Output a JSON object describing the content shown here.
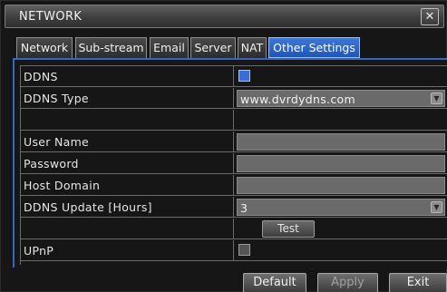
{
  "window": {
    "title": "NETWORK",
    "close_glyph": "✕"
  },
  "tabs": [
    {
      "label": "Network",
      "active": false
    },
    {
      "label": "Sub-stream",
      "active": false
    },
    {
      "label": "Email",
      "active": false
    },
    {
      "label": "Server",
      "active": false
    },
    {
      "label": "NAT",
      "active": false
    },
    {
      "label": "Other Settings",
      "active": true
    }
  ],
  "form": {
    "ddns": {
      "label": "DDNS",
      "checked": true
    },
    "ddns_type": {
      "label": "DDNS Type",
      "value": "www.dvrdydns.com"
    },
    "blank": {
      "label": ""
    },
    "user_name": {
      "label": "User Name",
      "value": ""
    },
    "password": {
      "label": "Password",
      "value": ""
    },
    "host_domain": {
      "label": "Host Domain",
      "value": ""
    },
    "ddns_update": {
      "label": "DDNS Update [Hours]",
      "value": "3"
    },
    "test": {
      "label": "Test"
    },
    "upnp": {
      "label": "UPnP",
      "checked": false
    }
  },
  "footer": {
    "default_label": "Default",
    "apply_label": "Apply",
    "exit_label": "Exit"
  },
  "colors": {
    "accent": "#2f66cc",
    "background": "#161616"
  },
  "icons": {
    "close": "close-icon",
    "dropdown": "chevron-down-icon"
  }
}
